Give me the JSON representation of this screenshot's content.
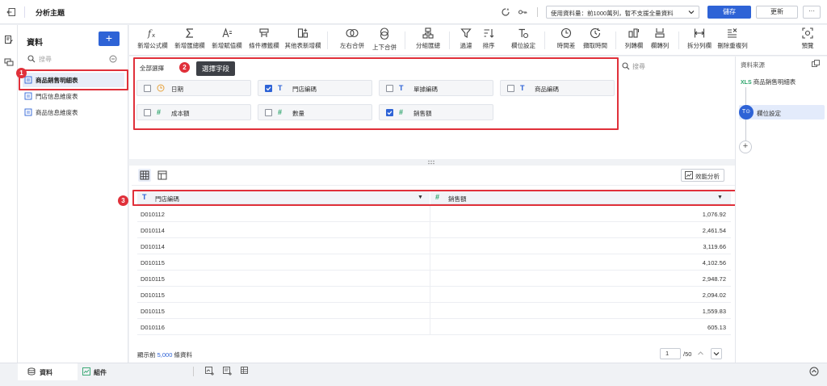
{
  "topbar": {
    "title": "分析主題",
    "data_usage": "使用資料量：前1000萬列，暫不支援全量資料",
    "save_label": "儲存",
    "update_label": "更新",
    "more_label": "···"
  },
  "data_panel": {
    "title": "資料",
    "add_label": "+",
    "search_placeholder": "搜尋",
    "tables": [
      {
        "label": "商品銷售明細表",
        "selected": true
      },
      {
        "label": "門店信息維度表",
        "selected": false
      },
      {
        "label": "商品信息維度表",
        "selected": false
      }
    ]
  },
  "toolbar": {
    "items": [
      {
        "label": "新增公式欄",
        "icon": "fx-icon"
      },
      {
        "label": "新增匯總欄",
        "icon": "sigma-icon"
      },
      {
        "label": "新增賦值欄",
        "icon": "assign-icon"
      },
      {
        "label": "條件標籤欄",
        "icon": "condition-icon"
      },
      {
        "label": "其他表新增欄",
        "icon": "add-other-table-icon"
      },
      {
        "label": "左右合併",
        "icon": "merge-horizontal-icon"
      },
      {
        "label": "上下合併",
        "icon": "merge-vertical-icon"
      },
      {
        "label": "分組匯總",
        "icon": "group-summary-icon"
      },
      {
        "label": "過濾",
        "icon": "filter-icon"
      },
      {
        "label": "排序",
        "icon": "sort-icon"
      },
      {
        "label": "欄位設定",
        "icon": "field-setting-icon"
      },
      {
        "label": "時間差",
        "icon": "time-diff-icon"
      },
      {
        "label": "擷取時間",
        "icon": "extract-time-icon"
      },
      {
        "label": "列轉欄",
        "icon": "row-to-column-icon"
      },
      {
        "label": "欄轉列",
        "icon": "column-to-row-icon"
      },
      {
        "label": "拆分列欄",
        "icon": "split-icon"
      },
      {
        "label": "刪除重複列",
        "icon": "dedupe-icon"
      },
      {
        "label": "預覽",
        "icon": "preview-icon"
      }
    ]
  },
  "field_select": {
    "select_all": "全部選擇",
    "tooltip": "選擇字段",
    "search_placeholder": "搜尋",
    "fields": [
      {
        "label": "日期",
        "type": "date",
        "checked": false
      },
      {
        "label": "門店編碼",
        "type": "text",
        "checked": true
      },
      {
        "label": "單據編碼",
        "type": "text",
        "checked": false
      },
      {
        "label": "商品編碼",
        "type": "text",
        "checked": false
      },
      {
        "label": "成本額",
        "type": "number",
        "checked": false
      },
      {
        "label": "數量",
        "type": "number",
        "checked": false
      },
      {
        "label": "銷售額",
        "type": "number",
        "checked": true
      }
    ]
  },
  "preview": {
    "perf_label": "效能分析",
    "columns": [
      "門店編碼",
      "銷售額"
    ],
    "rows": [
      [
        "D010112",
        "1,076.92"
      ],
      [
        "D010114",
        "2,461.54"
      ],
      [
        "D010114",
        "3,119.66"
      ],
      [
        "D010115",
        "4,102.56"
      ],
      [
        "D010115",
        "2,948.72"
      ],
      [
        "D010115",
        "2,094.02"
      ],
      [
        "D010115",
        "1,559.83"
      ],
      [
        "D010116",
        "605.13"
      ]
    ],
    "footer_prefix": "顯示前",
    "footer_count": "5,000",
    "footer_suffix": "條資料",
    "page": "1",
    "total_pages": "/50"
  },
  "right_panel": {
    "title": "資料來源",
    "source_label": "商品銷售明細表",
    "source_badge": "XLS",
    "step_label": "欄位設定",
    "step_icon_label": "T⊙",
    "add_label": "+"
  },
  "bottom": {
    "tab_data": "資料",
    "tab_component": "組件"
  },
  "annotations": {
    "badge1": "1",
    "badge2": "2",
    "badge3": "3"
  },
  "colors": {
    "accent": "#2e63d6",
    "highlight": "#e0303a",
    "number_field": "#2aa36a",
    "date_field": "#e6a23c"
  }
}
